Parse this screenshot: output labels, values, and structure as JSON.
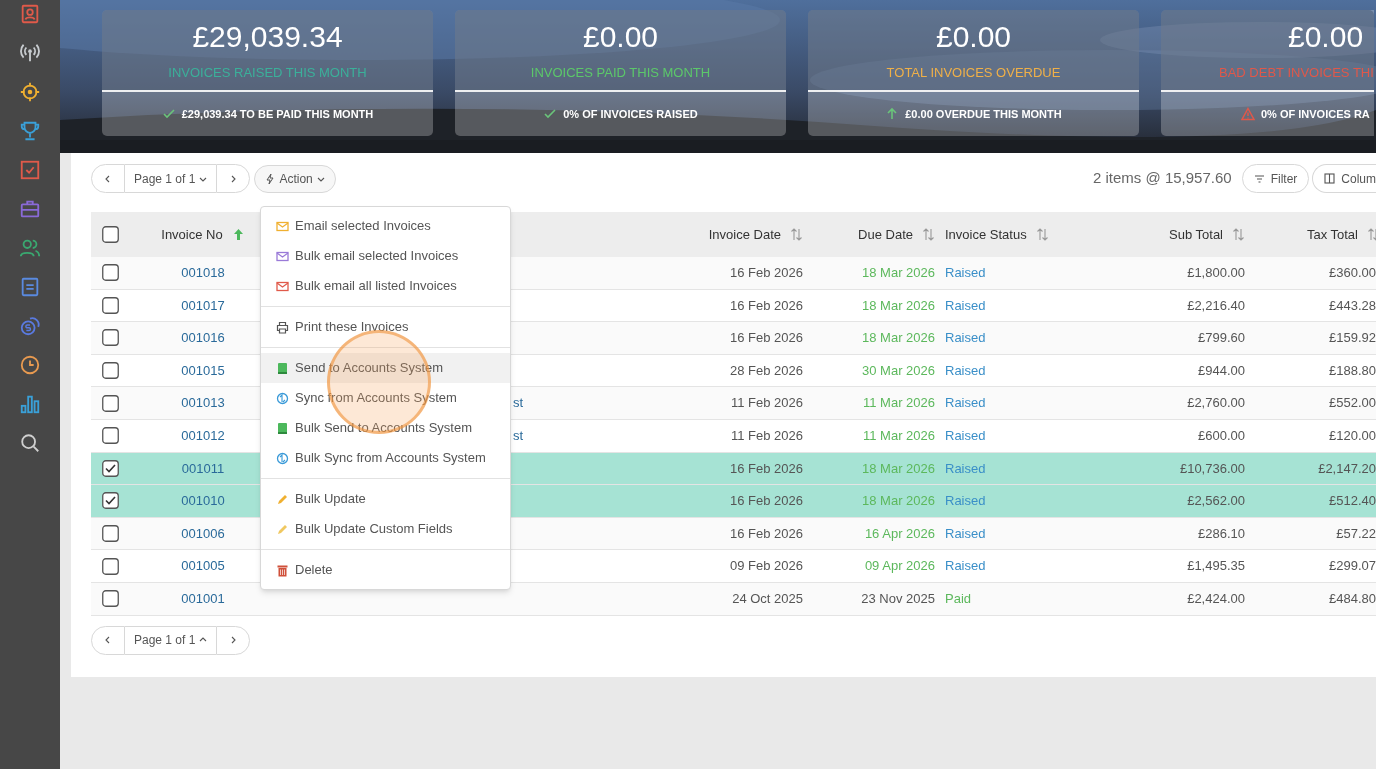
{
  "sidebar": {
    "items": [
      {
        "color": "#e05a4a"
      },
      {
        "color": "#c8ccd0"
      },
      {
        "color": "#f0b030"
      },
      {
        "color": "#3aa0d8"
      },
      {
        "color": "#e05a4a"
      },
      {
        "color": "#8a6ad8"
      },
      {
        "color": "#3aa870"
      },
      {
        "color": "#5a8ae0"
      },
      {
        "color": "#5a7ae0"
      },
      {
        "color": "#e89a50"
      },
      {
        "color": "#3aa0d8"
      },
      {
        "color": "#d0d0d0"
      }
    ]
  },
  "summary_cards": [
    {
      "kind": "check",
      "value": "£29,039.34",
      "label": "INVOICES RAISED THIS MONTH",
      "color": "#3bb09a",
      "footer": "£29,039.34 TO BE PAID THIS MONTH"
    },
    {
      "kind": "check",
      "value": "£0.00",
      "label": "INVOICES PAID THIS MONTH",
      "color": "#5cc86a",
      "footer": "0% OF INVOICES RAISED"
    },
    {
      "kind": "trend",
      "value": "£0.00",
      "label": "TOTAL INVOICES OVERDUE",
      "color": "#f0b048",
      "footer": "£0.00 OVERDUE THIS MONTH"
    },
    {
      "kind": "warning",
      "value": "£0.00",
      "label": "BAD DEBT INVOICES THI",
      "color": "#e0584a",
      "footer": "0% OF INVOICES RA"
    }
  ],
  "toolbar": {
    "pager": {
      "label": "Page 1 of 1"
    },
    "action": "Action",
    "summary": "2 items @ 15,957.60",
    "filter": "Filter",
    "columns": "Colum"
  },
  "table": {
    "all_selected": false,
    "columns": [
      {
        "label": "Invoice No",
        "sorted": true
      },
      {
        "label": "Invoice Date",
        "sorted": false
      },
      {
        "label": "Due Date",
        "sorted": false
      },
      {
        "label": "Invoice Status",
        "sorted": false
      },
      {
        "label": "Sub Total",
        "sorted": false
      },
      {
        "label": "Tax Total",
        "sorted": false
      }
    ],
    "rows": [
      {
        "selected": false,
        "invoice_no": "001018",
        "invoice_date": "16 Feb 2026",
        "due_date": {
          "text": "18 Mar 2026",
          "color": "#5cb85c"
        },
        "status": {
          "text": "Raised",
          "color": "#3a8fc8"
        },
        "sub_total": "£1,800.00",
        "tax_total": "£360.00"
      },
      {
        "selected": false,
        "invoice_no": "001017",
        "invoice_date": "16 Feb 2026",
        "due_date": {
          "text": "18 Mar 2026",
          "color": "#5cb85c"
        },
        "status": {
          "text": "Raised",
          "color": "#3a8fc8"
        },
        "sub_total": "£2,216.40",
        "tax_total": "£443.28"
      },
      {
        "selected": false,
        "invoice_no": "001016",
        "invoice_date": "16 Feb 2026",
        "due_date": {
          "text": "18 Mar 2026",
          "color": "#5cb85c"
        },
        "status": {
          "text": "Raised",
          "color": "#3a8fc8"
        },
        "sub_total": "£799.60",
        "tax_total": "£159.92"
      },
      {
        "selected": false,
        "invoice_no": "001015",
        "invoice_date": "28 Feb 2026",
        "due_date": {
          "text": "30 Mar 2026",
          "color": "#5cb85c"
        },
        "status": {
          "text": "Raised",
          "color": "#3a8fc8"
        },
        "sub_total": "£944.00",
        "tax_total": "£188.80"
      },
      {
        "selected": false,
        "invoice_no": "001013",
        "column_3": "st",
        "invoice_date": "11 Feb 2026",
        "due_date": {
          "text": "11 Mar 2026",
          "color": "#5cb85c"
        },
        "status": {
          "text": "Raised",
          "color": "#3a8fc8"
        },
        "sub_total": "£2,760.00",
        "tax_total": "£552.00"
      },
      {
        "selected": false,
        "invoice_no": "001012",
        "column_3": "st",
        "invoice_date": "11 Feb 2026",
        "due_date": {
          "text": "11 Mar 2026",
          "color": "#5cb85c"
        },
        "status": {
          "text": "Raised",
          "color": "#3a8fc8"
        },
        "sub_total": "£600.00",
        "tax_total": "£120.00"
      },
      {
        "selected": true,
        "invoice_no": "001011",
        "invoice_date": "16 Feb 2026",
        "due_date": {
          "text": "18 Mar 2026",
          "color": "#5cb85c"
        },
        "status": {
          "text": "Raised",
          "color": "#3a8fc8"
        },
        "sub_total": "£10,736.00",
        "tax_total": "£2,147.20"
      },
      {
        "selected": true,
        "invoice_no": "001010",
        "invoice_date": "16 Feb 2026",
        "due_date": {
          "text": "18 Mar 2026",
          "color": "#5cb85c"
        },
        "status": {
          "text": "Raised",
          "color": "#3a8fc8"
        },
        "sub_total": "£2,562.00",
        "tax_total": "£512.40"
      },
      {
        "selected": false,
        "invoice_no": "001006",
        "invoice_date": "16 Feb 2026",
        "due_date": {
          "text": "16 Apr 2026",
          "color": "#5cb85c"
        },
        "status": {
          "text": "Raised",
          "color": "#3a8fc8"
        },
        "sub_total": "£286.10",
        "tax_total": "£57.22"
      },
      {
        "selected": false,
        "invoice_no": "001005",
        "invoice_date": "09 Feb 2026",
        "due_date": {
          "text": "09 Apr 2026",
          "color": "#5cb85c"
        },
        "status": {
          "text": "Raised",
          "color": "#3a8fc8"
        },
        "sub_total": "£1,495.35",
        "tax_total": "£299.07"
      },
      {
        "selected": false,
        "invoice_no": "001001",
        "invoice_date": "24 Oct 2025",
        "due_date": {
          "text": "23 Nov 2025",
          "color": "#555555"
        },
        "status": {
          "text": "Paid",
          "color": "#5cb85c"
        },
        "sub_total": "£2,424.00",
        "tax_total": "£484.80"
      }
    ]
  },
  "action_menu": {
    "groups": [
      [
        {
          "kind": "mail",
          "label": "Email selected Invoices",
          "color": "#f0b030",
          "highlighted": false
        },
        {
          "kind": "mail",
          "label": "Bulk email selected Invoices",
          "color": "#9a7ad8",
          "highlighted": false
        },
        {
          "kind": "mail",
          "label": "Bulk email all listed Invoices",
          "color": "#e05a4a",
          "highlighted": false
        }
      ],
      [
        {
          "kind": "print",
          "label": "Print these Invoices",
          "color": "#555555",
          "highlighted": false
        }
      ],
      [
        {
          "kind": "send",
          "label": "Send to Accounts System",
          "color": "#4cb85c",
          "highlighted": true
        },
        {
          "kind": "sync",
          "label": "Sync from Accounts System",
          "color": "#3a9ad8",
          "highlighted": false
        },
        {
          "kind": "send",
          "label": "Bulk Send to Accounts System",
          "color": "#4cb85c",
          "highlighted": false
        },
        {
          "kind": "sync",
          "label": "Bulk Sync from Accounts System",
          "color": "#3a9ad8",
          "highlighted": false
        }
      ],
      [
        {
          "kind": "edit",
          "label": "Bulk Update",
          "color": "#f0b030",
          "highlighted": false
        },
        {
          "kind": "edit",
          "label": "Bulk Update Custom Fields",
          "color": "#f0c860",
          "highlighted": false
        }
      ],
      [
        {
          "kind": "delete",
          "label": "Delete",
          "color": "#d0503a",
          "highlighted": false
        }
      ]
    ]
  },
  "footer_pager": {
    "label": "Page 1 of 1"
  }
}
